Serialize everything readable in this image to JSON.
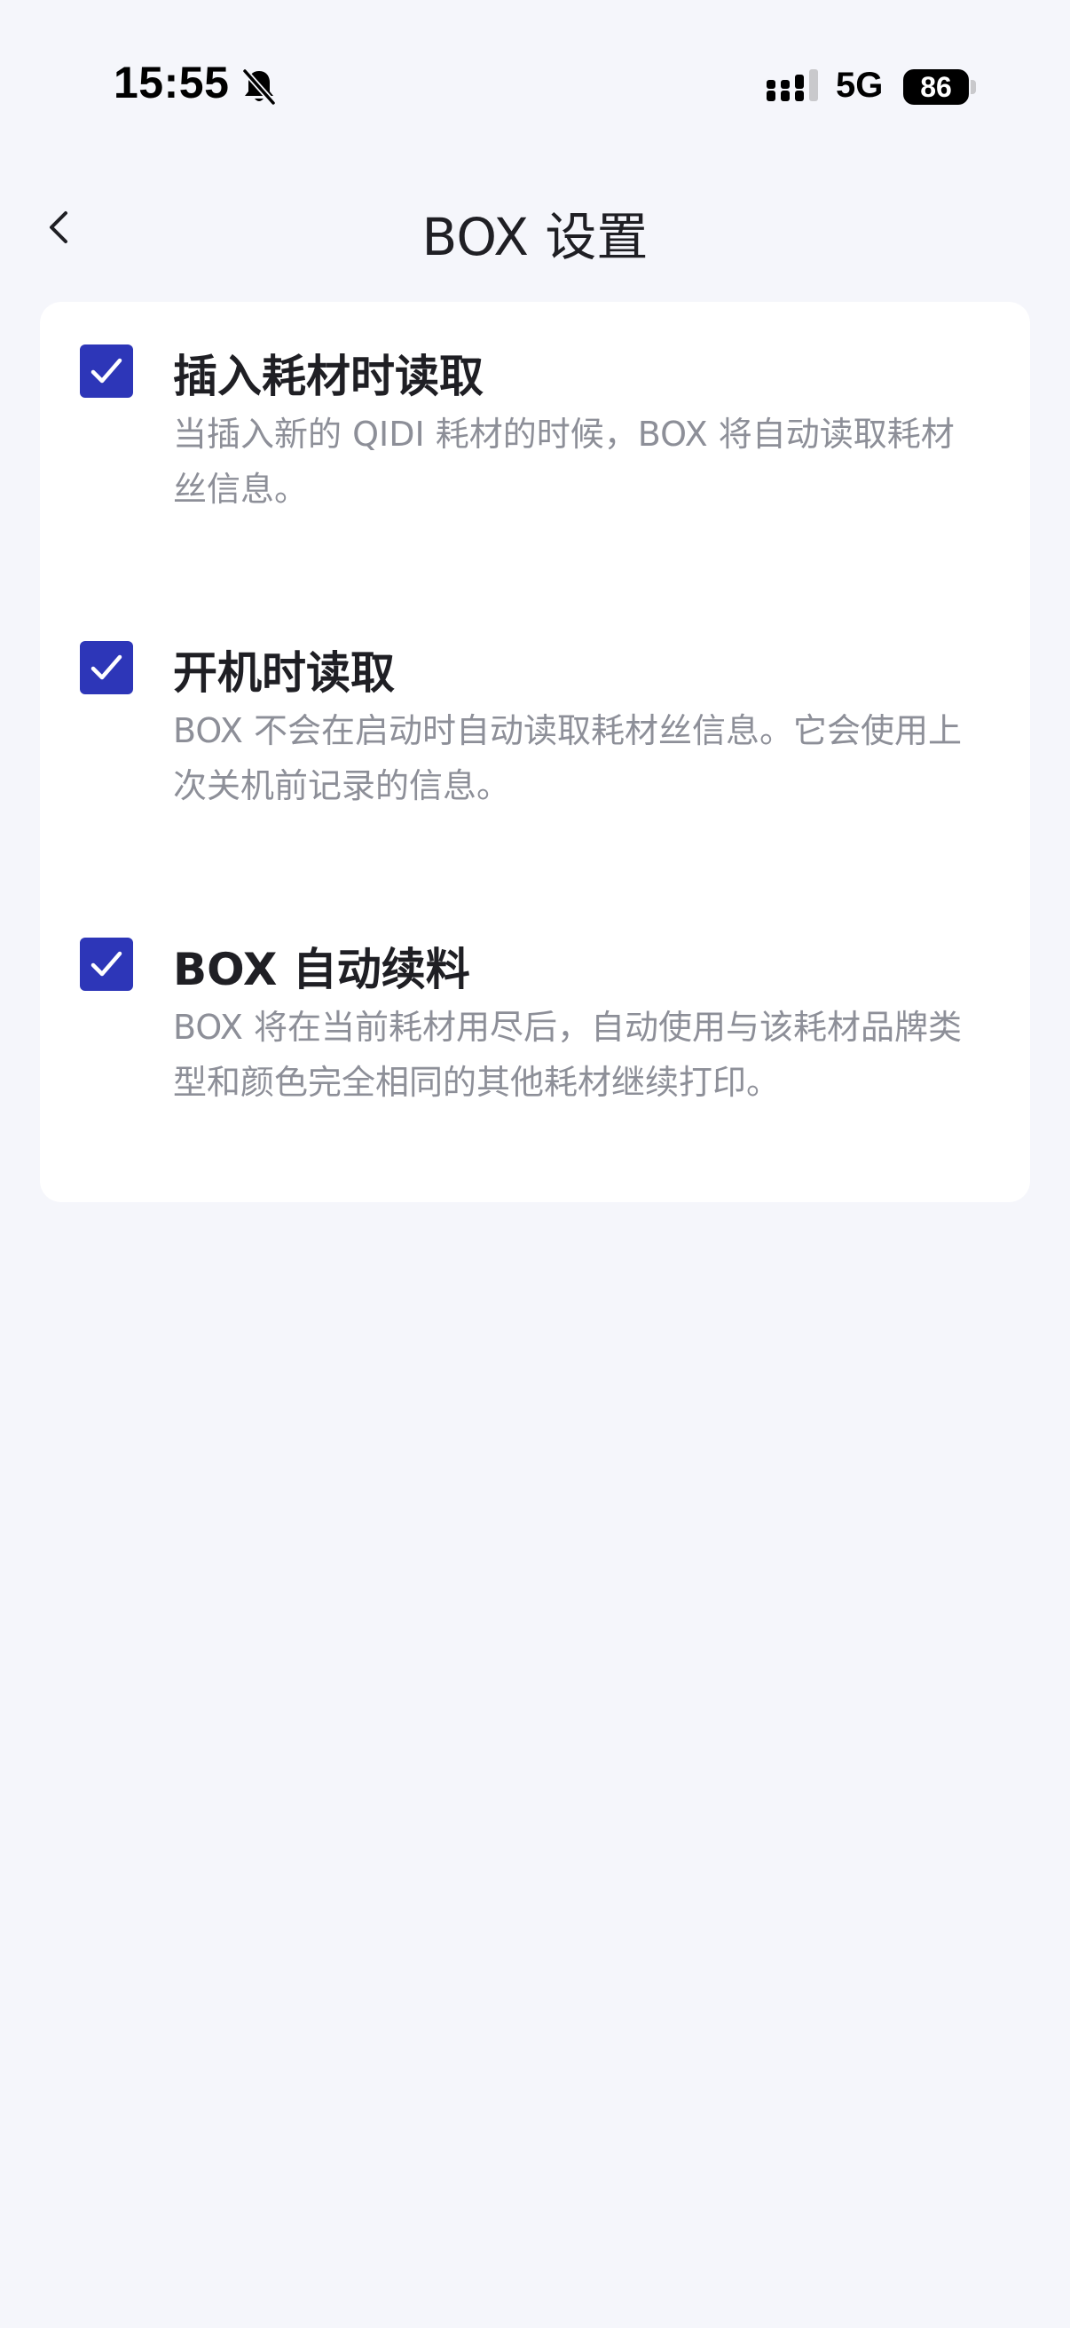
{
  "status_bar": {
    "time": "15:55",
    "network": "5G",
    "battery": "86"
  },
  "nav": {
    "title": "BOX 设置"
  },
  "settings": [
    {
      "title": "插入耗材时读取",
      "description": "当插入新的 QIDI 耗材的时候，BOX 将自动读取耗材丝信息。",
      "checked": true
    },
    {
      "title": "开机时读取",
      "description": "BOX 不会在启动时自动读取耗材丝信息。它会使用上次关机前记录的信息。",
      "checked": true
    },
    {
      "title": "BOX 自动续料",
      "description": "BOX 将在当前耗材用尽后，自动使用与该耗材品牌类型和颜色完全相同的其他耗材继续打印。",
      "checked": true
    }
  ],
  "colors": {
    "accent": "#2d36b8",
    "background": "#f5f6fb",
    "card": "#ffffff",
    "title_text": "#1f1f24",
    "desc_text": "#8d8f98"
  },
  "icons": {
    "back": "chevron-left-icon",
    "bell": "bell-slash-icon",
    "signal": "cellular-signal-icon",
    "battery": "battery-icon",
    "check": "checkmark-icon"
  }
}
